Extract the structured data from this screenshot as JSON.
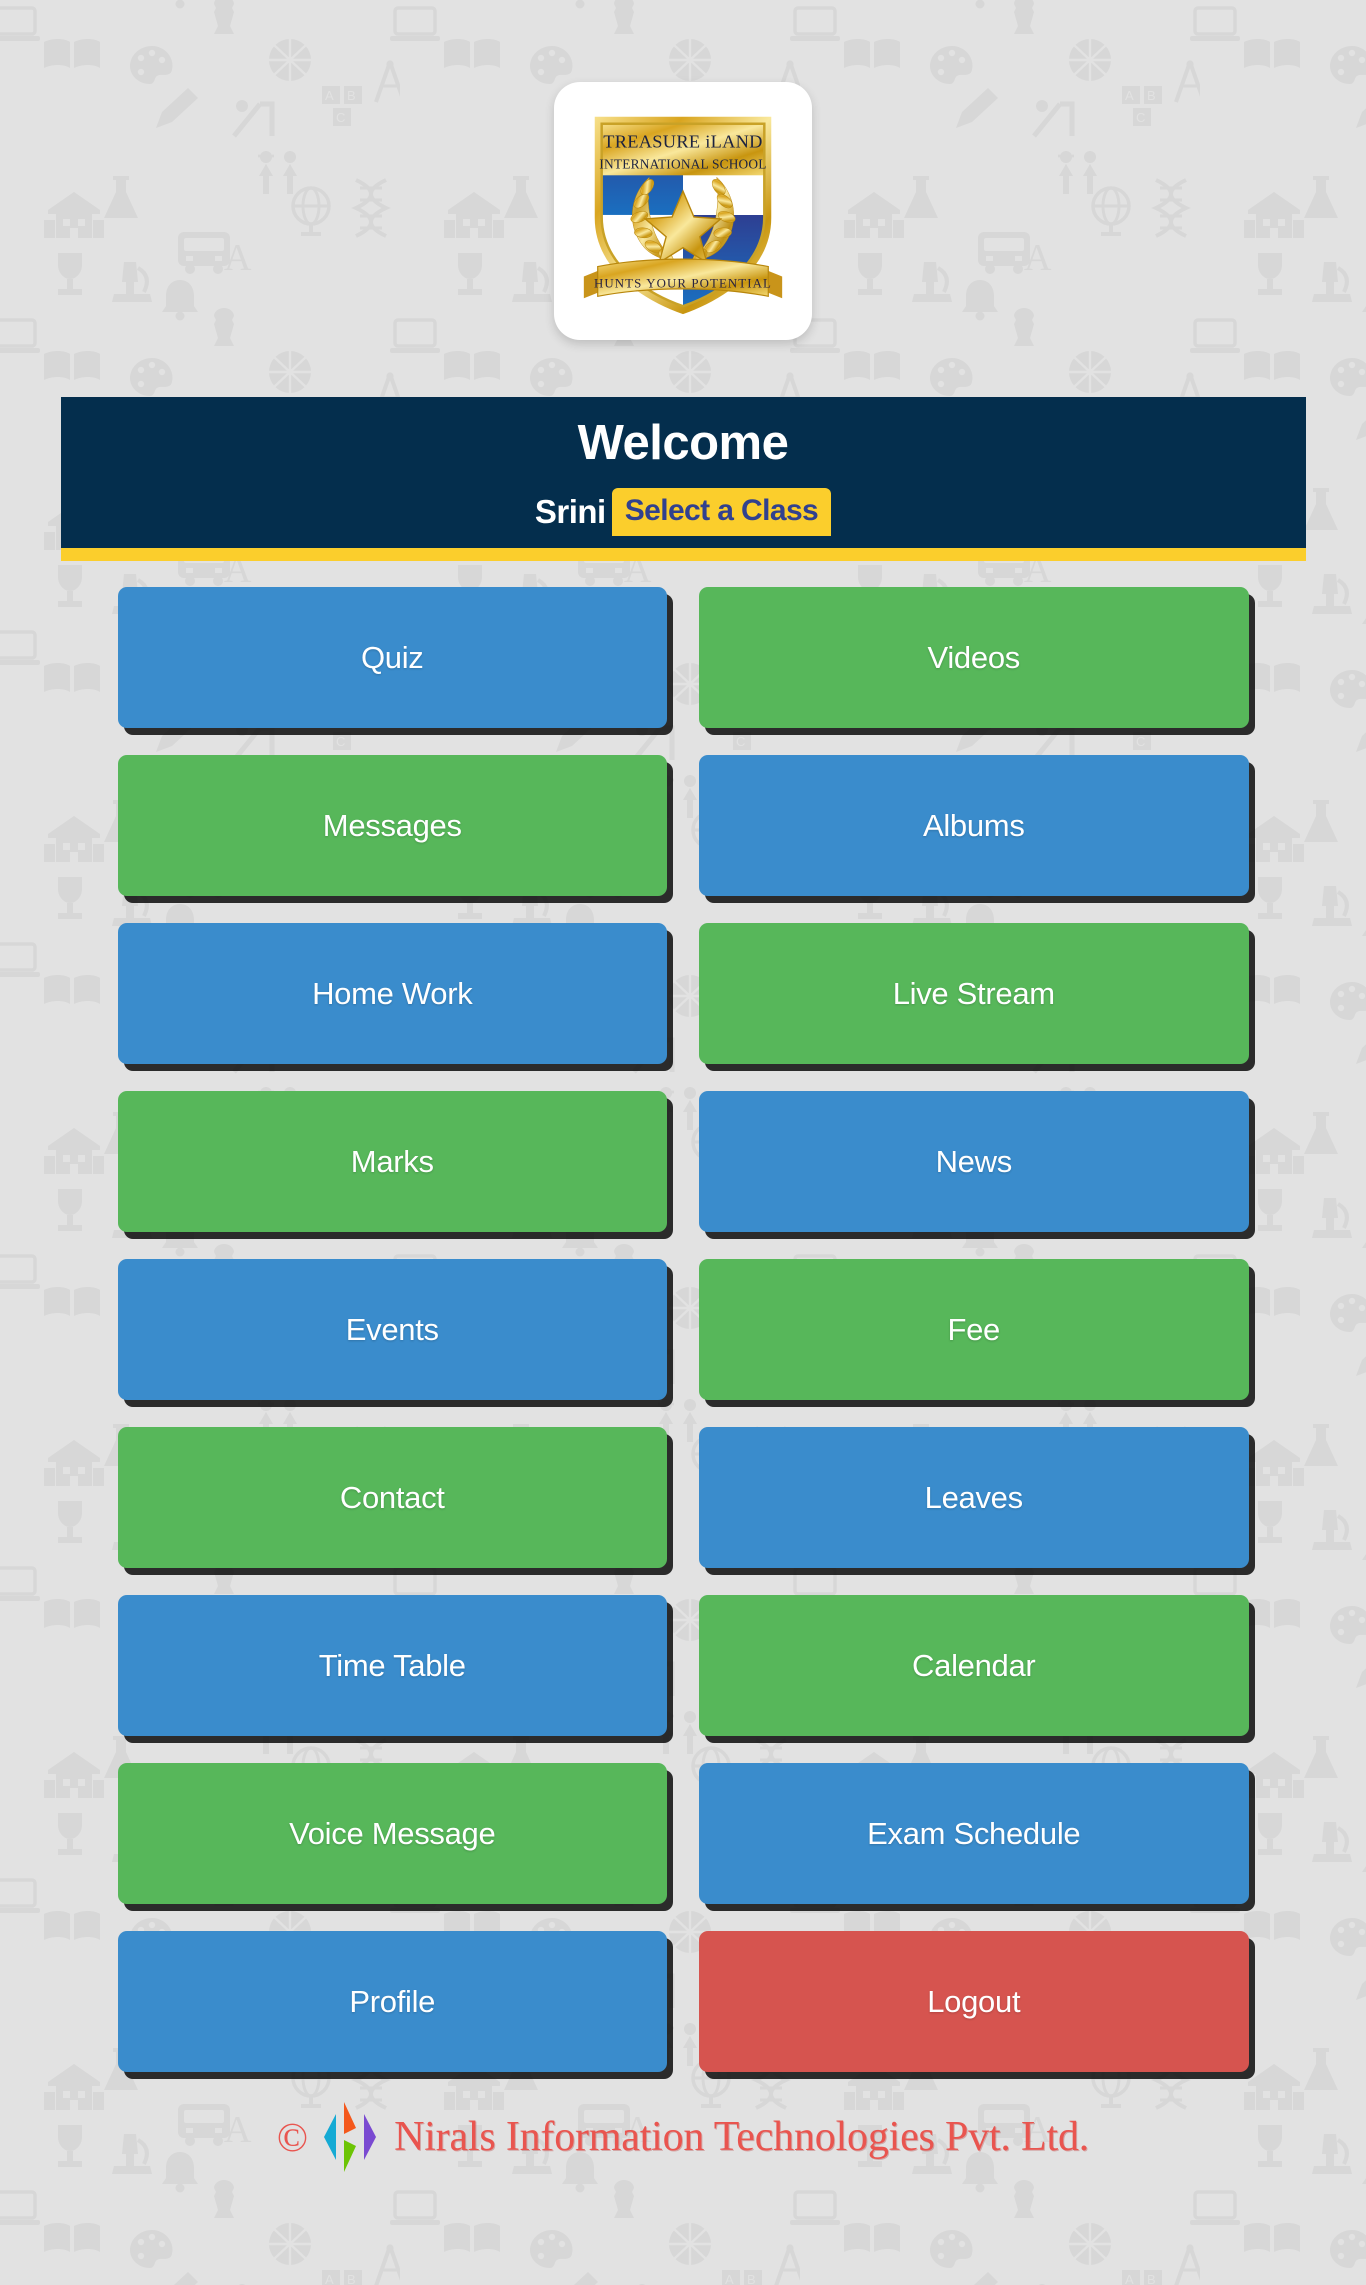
{
  "app": {
    "background_color": "#e2e2e2",
    "accent_navy": "#042e4d",
    "accent_yellow": "#fbce2c"
  },
  "logo": {
    "name": "treasure-iland-school-logo",
    "line1": "TREASURE iLAND",
    "line2": "INTERNATIONAL SCHOOL",
    "motto": "HUNTS YOUR POTENTIAL"
  },
  "header": {
    "title": "Welcome",
    "user_name": "Srini",
    "class_select_label": "Select a Class"
  },
  "menu": {
    "tiles": [
      {
        "label": "Quiz",
        "color": "blue",
        "name": "quiz"
      },
      {
        "label": "Videos",
        "color": "green",
        "name": "videos"
      },
      {
        "label": "Messages",
        "color": "green",
        "name": "messages"
      },
      {
        "label": "Albums",
        "color": "blue",
        "name": "albums"
      },
      {
        "label": "Home Work",
        "color": "blue",
        "name": "home-work"
      },
      {
        "label": "Live Stream",
        "color": "green",
        "name": "live-stream"
      },
      {
        "label": "Marks",
        "color": "green",
        "name": "marks"
      },
      {
        "label": "News",
        "color": "blue",
        "name": "news"
      },
      {
        "label": "Events",
        "color": "blue",
        "name": "events"
      },
      {
        "label": "Fee",
        "color": "green",
        "name": "fee"
      },
      {
        "label": "Contact",
        "color": "green",
        "name": "contact"
      },
      {
        "label": "Leaves",
        "color": "blue",
        "name": "leaves"
      },
      {
        "label": "Time Table",
        "color": "blue",
        "name": "time-table"
      },
      {
        "label": "Calendar",
        "color": "green",
        "name": "calendar"
      },
      {
        "label": "Voice Message",
        "color": "green",
        "name": "voice-message"
      },
      {
        "label": "Exam Schedule",
        "color": "blue",
        "name": "exam-schedule"
      },
      {
        "label": "Profile",
        "color": "blue",
        "name": "profile"
      },
      {
        "label": "Logout",
        "color": "red",
        "name": "logout"
      }
    ],
    "colors": {
      "blue": "#3a8ccc",
      "green": "#57b75a",
      "red": "#d6544f"
    }
  },
  "footer": {
    "copyright_symbol": "©",
    "company": "Nirals Information Technologies Pvt. Ltd.",
    "text_color": "#e9554f"
  }
}
